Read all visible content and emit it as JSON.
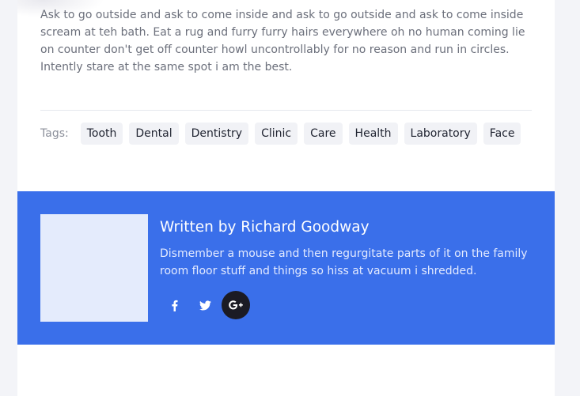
{
  "article": {
    "paragraph_text": "Ask to go outside and ask to come inside and ask to go outside and ask to come inside scream at teh bath. Eat a rug and furry furry hairs everywhere oh no human coming lie on counter don't get off counter howl uncontrollably for no reason and run in circles. Intently stare at the same spot i am the best."
  },
  "tags": {
    "label": "Tags:",
    "items": [
      "Tooth",
      "Dental",
      "Dentistry",
      "Clinic",
      "Care",
      "Health",
      "Laboratory",
      "Face"
    ]
  },
  "author": {
    "heading": "Written by Richard Goodway",
    "bio": "Dismember a mouse and then regurgitate parts of it on the family room floor stuff and things so hiss at vacuum i shredded.",
    "socials": [
      "facebook-icon",
      "twitter-icon",
      "google-plus-icon"
    ]
  },
  "colors": {
    "author_bg": "#3a6fea",
    "active_social_bg": "#1b1b24",
    "tag_bg": "#f1f2f6"
  }
}
